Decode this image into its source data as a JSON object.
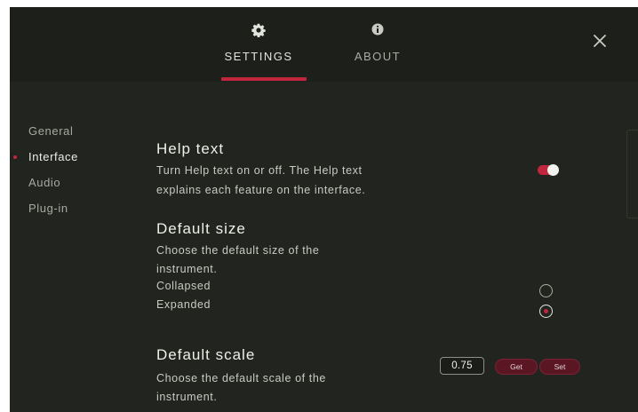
{
  "tabs": [
    {
      "label": "SETTINGS",
      "icon": "gear-icon",
      "active": true
    },
    {
      "label": "ABOUT",
      "icon": "info-icon",
      "active": false
    }
  ],
  "sidebar": {
    "items": [
      {
        "label": "General",
        "active": false
      },
      {
        "label": "Interface",
        "active": true
      },
      {
        "label": "Audio",
        "active": false
      },
      {
        "label": "Plug-in",
        "active": false
      }
    ]
  },
  "help_text": {
    "title": "Help text",
    "desc_line1": "Turn Help text on or off. The Help text",
    "desc_line2": "explains each feature on the interface.",
    "enabled": true
  },
  "default_size": {
    "title": "Default size",
    "desc_line1": "Choose the default size of the",
    "desc_line2": "instrument.",
    "options": [
      "Collapsed",
      "Expanded"
    ],
    "selected": "Expanded"
  },
  "default_scale": {
    "title": "Default scale",
    "desc_line1": "Choose the default scale of the",
    "desc_line2": "instrument.",
    "value": "0.75",
    "get_label": "Get",
    "set_label": "Set"
  },
  "colors": {
    "accent": "#c2263d",
    "background": "#22241f",
    "topbar": "#1d1f1b"
  }
}
